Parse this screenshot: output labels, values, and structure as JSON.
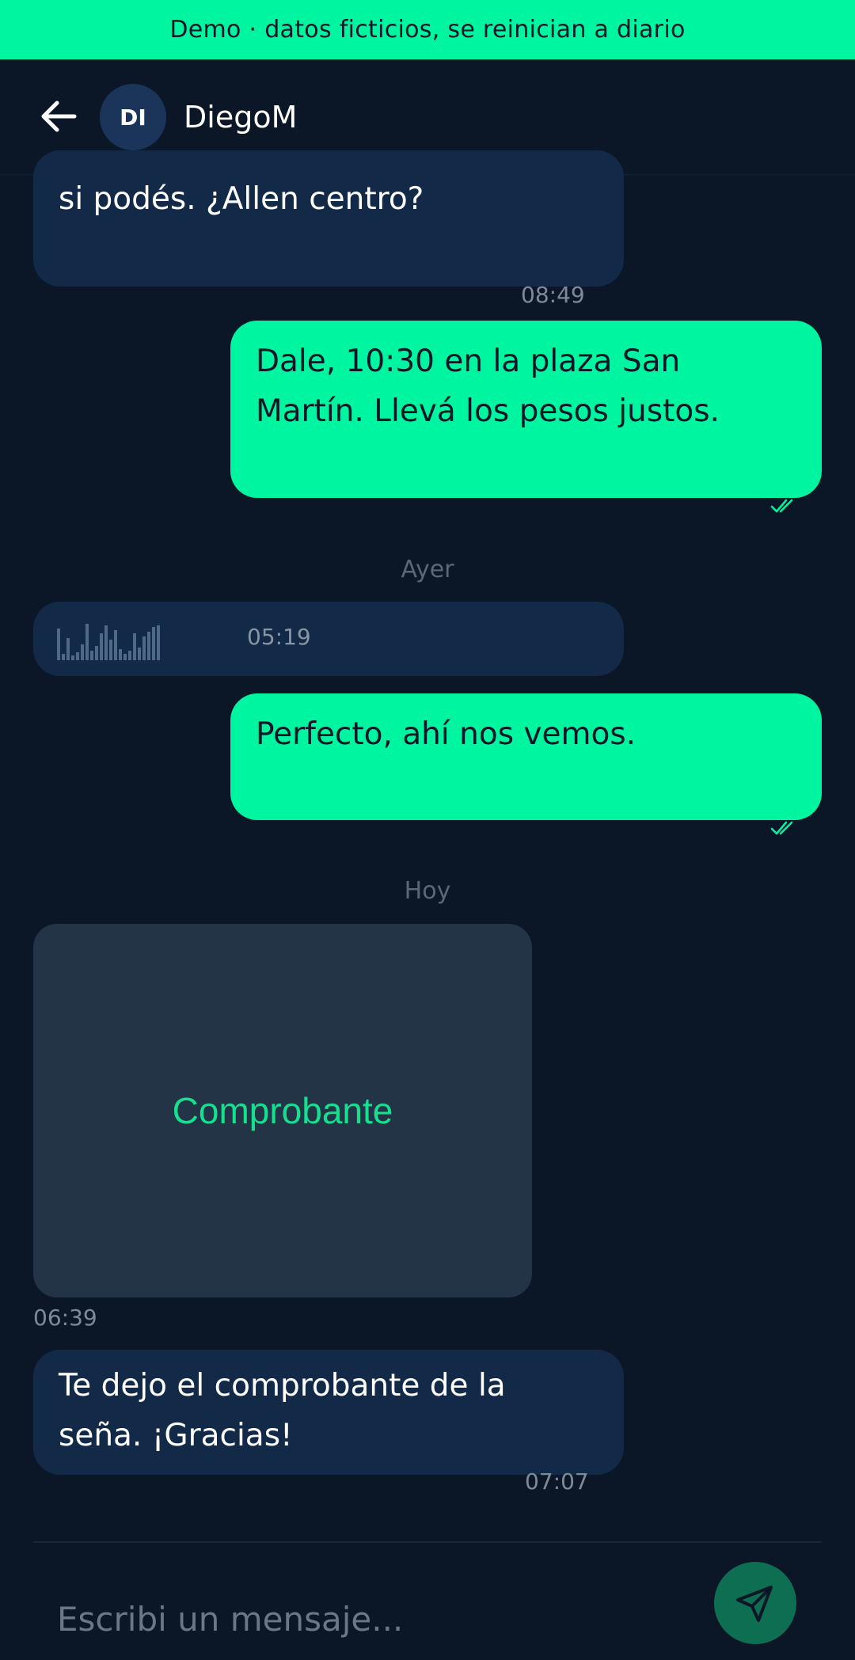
{
  "banner": {
    "text": "Demo · datos ficticios, se reinician a diario"
  },
  "header": {
    "avatar_initials": "DI",
    "contact_name": "DiegoM"
  },
  "messages": [
    {
      "direction": "in",
      "text": "si podés. ¿Allen centro?",
      "time": "08:49"
    },
    {
      "direction": "out",
      "text": "Dale, 10:30 en la plaza San Martín. Llevá los pesos justos.",
      "status": "read"
    },
    {
      "day_separator": "Ayer"
    },
    {
      "direction": "in",
      "type": "voice",
      "time": "05:19"
    },
    {
      "direction": "out",
      "text": "Perfecto, ahí nos vemos.",
      "status": "read"
    },
    {
      "day_separator": "Hoy"
    },
    {
      "direction": "in",
      "type": "image",
      "label": "Comprobante",
      "time": "06:39"
    },
    {
      "direction": "in",
      "text": "Te dejo el comprobante de la seña. ¡Gracias!",
      "time": "07:07"
    }
  ],
  "composer": {
    "placeholder": "Escribi un mensaje..."
  },
  "colors": {
    "accent": "#00f5a0",
    "background": "#0b1727",
    "incoming_bubble": "#122a47",
    "send_button": "#0e6e52"
  },
  "icons": {
    "back": "arrow-left-icon",
    "read": "double-check-icon",
    "send": "send-icon"
  }
}
